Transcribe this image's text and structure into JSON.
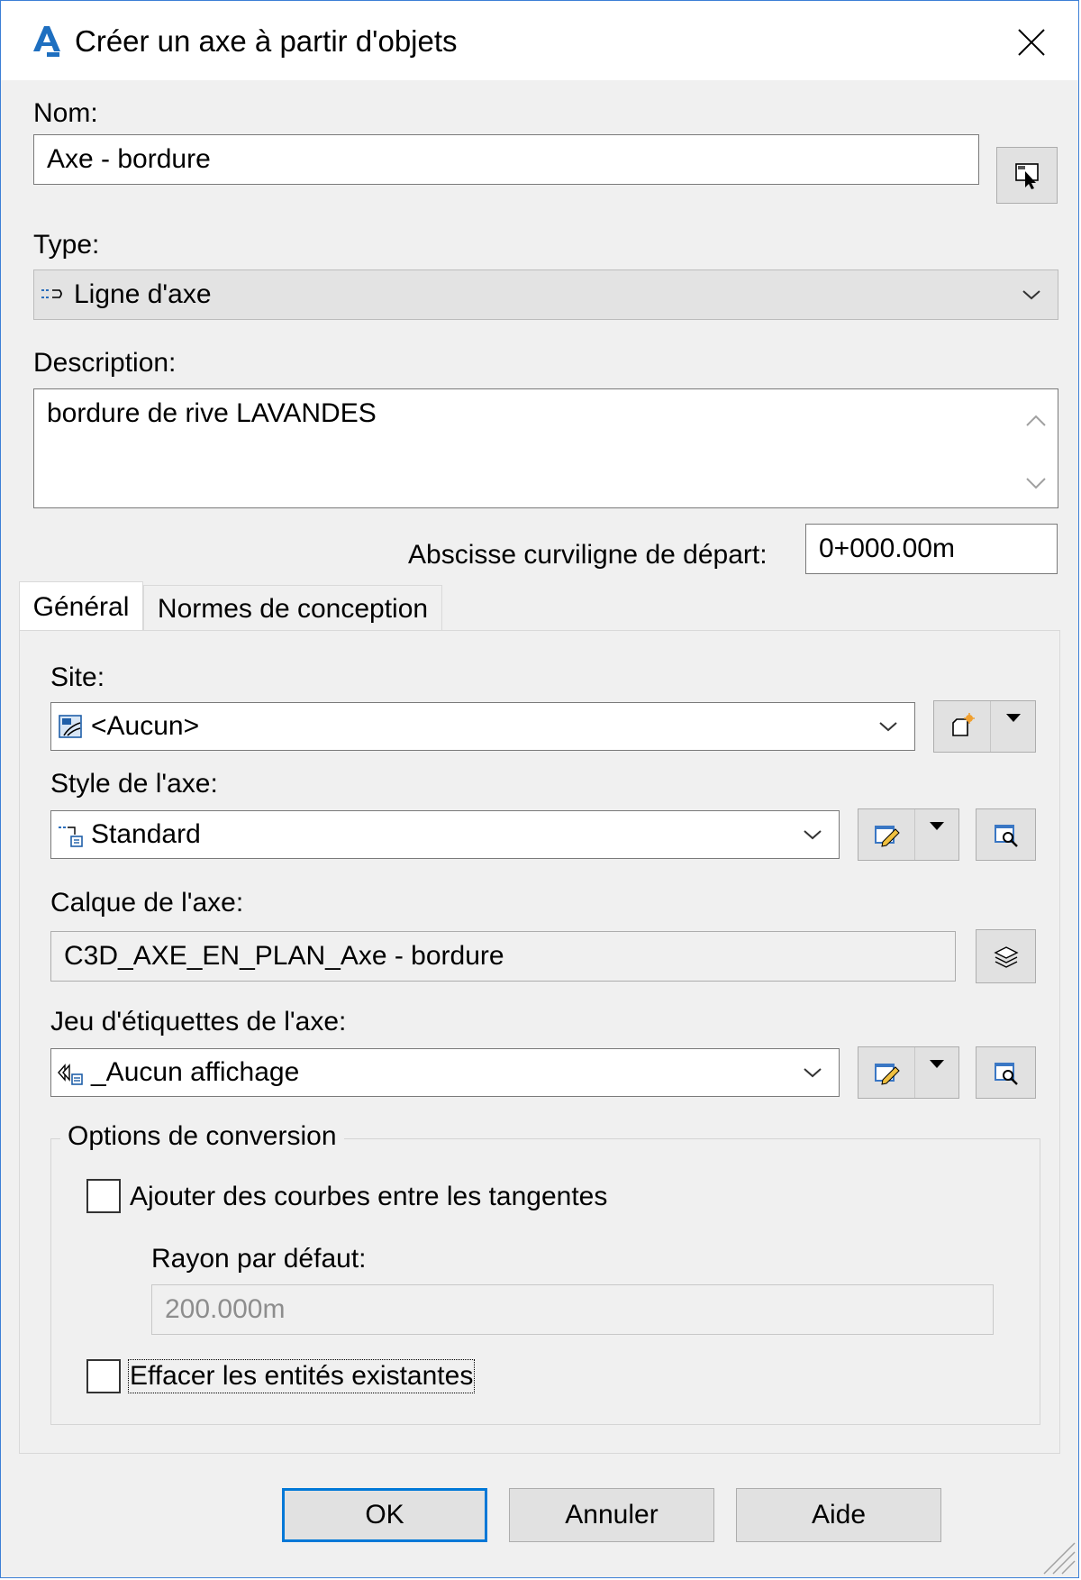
{
  "window": {
    "title": "Créer un axe à partir d'objets",
    "logo": "autocad-civil-a-logo",
    "accent": "#0078d7"
  },
  "name": {
    "label": "Nom:",
    "value": "Axe - bordure"
  },
  "type": {
    "label": "Type:",
    "value": "Ligne d'axe",
    "icon": "centerline-icon"
  },
  "description": {
    "label": "Description:",
    "value": "bordure de rive LAVANDES"
  },
  "start_station": {
    "label": "Abscisse curviligne de départ:",
    "value": "0+000.00m"
  },
  "tabs": [
    {
      "label": "Général",
      "active": true
    },
    {
      "label": "Normes de conception",
      "active": false
    }
  ],
  "general": {
    "site": {
      "label": "Site:",
      "value": "<Aucun>",
      "icon": "site-icon"
    },
    "style": {
      "label": "Style de l'axe:",
      "value": "Standard",
      "icon": "alignment-style-icon"
    },
    "layer": {
      "label": "Calque de l'axe:",
      "value": "C3D_AXE_EN_PLAN_Axe - bordure"
    },
    "label_set": {
      "label": "Jeu d'étiquettes de l'axe:",
      "value": "_Aucun affichage",
      "icon": "label-set-icon"
    }
  },
  "conversion": {
    "title": "Options de conversion",
    "add_curves": {
      "label": "Ajouter des courbes entre les tangentes",
      "checked": false
    },
    "radius": {
      "label": "Rayon par défaut:",
      "value": "200.000m"
    },
    "erase": {
      "label": "Effacer les entités existantes",
      "checked": false
    }
  },
  "buttons": {
    "ok": "OK",
    "cancel": "Annuler",
    "help": "Aide"
  }
}
